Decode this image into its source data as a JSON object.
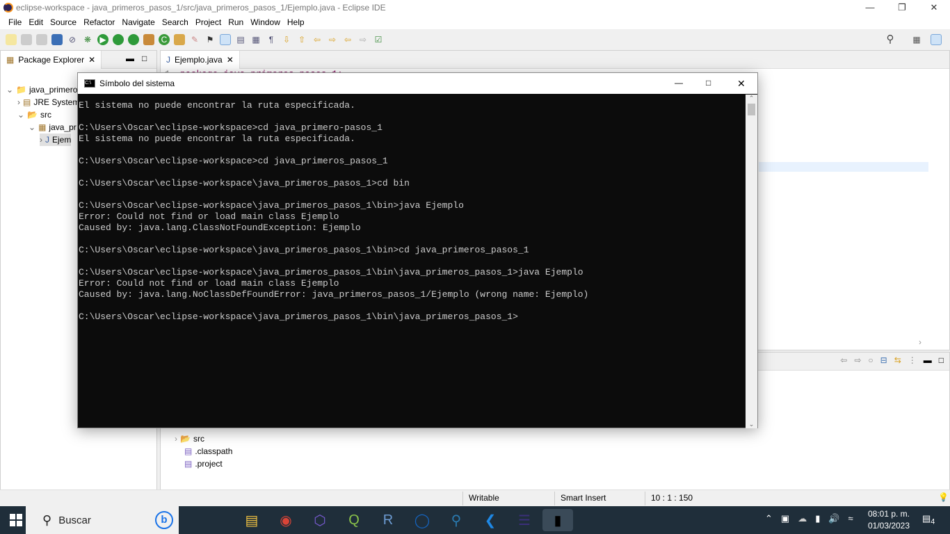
{
  "window": {
    "title": "eclipse-workspace - java_primeros_pasos_1/src/java_primeros_pasos_1/Ejemplo.java - Eclipse IDE"
  },
  "menu": [
    "File",
    "Edit",
    "Source",
    "Refactor",
    "Navigate",
    "Search",
    "Project",
    "Run",
    "Window",
    "Help"
  ],
  "package_explorer": {
    "tab": "Package Explorer",
    "items": [
      {
        "label": "java_primeros",
        "level": 0,
        "icon": "project-icon"
      },
      {
        "label": "JRE System",
        "level": 1,
        "icon": "library-icon"
      },
      {
        "label": "src",
        "level": 1,
        "icon": "source-folder-icon"
      },
      {
        "label": "java_pr",
        "level": 2,
        "icon": "package-icon"
      },
      {
        "label": "Ejem",
        "level": 3,
        "icon": "java-file-icon"
      }
    ]
  },
  "editor": {
    "tab": "Ejemplo.java",
    "line_number": "1",
    "code": "package java_primeros_pasos_1;"
  },
  "navigator": {
    "items": [
      {
        "label": "src",
        "icon": "folder-icon"
      },
      {
        "label": ".classpath",
        "icon": "xml-file-icon"
      },
      {
        "label": ".project",
        "icon": "xml-file-icon"
      }
    ]
  },
  "status": {
    "writable": "Writable",
    "insert_mode": "Smart Insert",
    "position": "10 : 1 : 150"
  },
  "cmd": {
    "title": "Símbolo del sistema",
    "lines": [
      "El sistema no puede encontrar la ruta especificada.",
      "",
      "C:\\Users\\Oscar\\eclipse-workspace>cd java_primero-pasos_1",
      "El sistema no puede encontrar la ruta especificada.",
      "",
      "C:\\Users\\Oscar\\eclipse-workspace>cd java_primeros_pasos_1",
      "",
      "C:\\Users\\Oscar\\eclipse-workspace\\java_primeros_pasos_1>cd bin",
      "",
      "C:\\Users\\Oscar\\eclipse-workspace\\java_primeros_pasos_1\\bin>java Ejemplo",
      "Error: Could not find or load main class Ejemplo",
      "Caused by: java.lang.ClassNotFoundException: Ejemplo",
      "",
      "C:\\Users\\Oscar\\eclipse-workspace\\java_primeros_pasos_1\\bin>cd java_primeros_pasos_1",
      "",
      "C:\\Users\\Oscar\\eclipse-workspace\\java_primeros_pasos_1\\bin\\java_primeros_pasos_1>java Ejemplo",
      "Error: Could not find or load main class Ejemplo",
      "Caused by: java.lang.NoClassDefFoundError: java_primeros_pasos_1/Ejemplo (wrong name: Ejemplo)",
      "",
      "C:\\Users\\Oscar\\eclipse-workspace\\java_primeros_pasos_1\\bin\\java_primeros_pasos_1>"
    ]
  },
  "taskbar": {
    "search_placeholder": "Buscar",
    "time": "08:01 p. m.",
    "date": "01/03/2023",
    "notifications": "4",
    "apps": [
      "file-explorer",
      "chrome",
      "copilot",
      "qgis",
      "r",
      "app-blue",
      "search-globe",
      "vscode",
      "eclipse",
      "cmd"
    ]
  }
}
